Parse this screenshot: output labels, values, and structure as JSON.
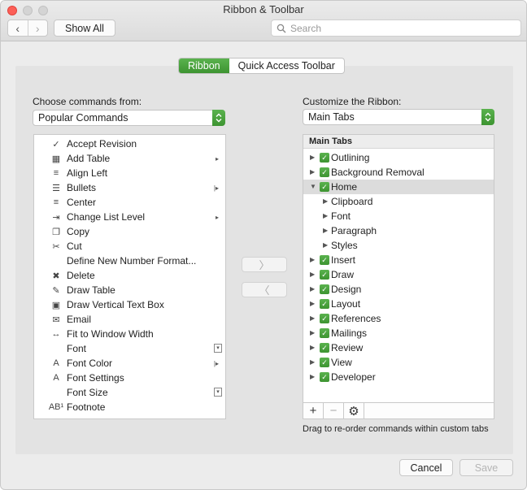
{
  "window": {
    "title": "Ribbon & Toolbar"
  },
  "toolbar": {
    "back_glyph": "‹",
    "forward_glyph": "›",
    "show_all": "Show All",
    "search_placeholder": "Search"
  },
  "tabs": [
    {
      "label": "Ribbon",
      "selected": true
    },
    {
      "label": "Quick Access Toolbar",
      "selected": false
    }
  ],
  "left": {
    "label": "Choose commands from:",
    "dropdown_value": "Popular Commands",
    "commands": [
      {
        "label": "Accept Revision",
        "icon": "accept-revision-icon",
        "glyph": "✓",
        "submenu": ""
      },
      {
        "label": "Add Table",
        "icon": "table-icon",
        "glyph": "▦",
        "submenu": "▸"
      },
      {
        "label": "Align Left",
        "icon": "align-left-icon",
        "glyph": "≡",
        "submenu": ""
      },
      {
        "label": "Bullets",
        "icon": "bullets-icon",
        "glyph": "☰",
        "submenu": "|▸"
      },
      {
        "label": "Center",
        "icon": "align-center-icon",
        "glyph": "≡",
        "submenu": ""
      },
      {
        "label": "Change List Level",
        "icon": "list-level-icon",
        "glyph": "⇥",
        "submenu": "▸"
      },
      {
        "label": "Copy",
        "icon": "copy-icon",
        "glyph": "❐",
        "submenu": ""
      },
      {
        "label": "Cut",
        "icon": "scissors-icon",
        "glyph": "✂",
        "submenu": ""
      },
      {
        "label": "Define New Number Format...",
        "icon": "",
        "glyph": "",
        "submenu": ""
      },
      {
        "label": "Delete",
        "icon": "delete-icon",
        "glyph": "✖",
        "submenu": ""
      },
      {
        "label": "Draw Table",
        "icon": "draw-table-icon",
        "glyph": "✎",
        "submenu": ""
      },
      {
        "label": "Draw Vertical Text Box",
        "icon": "text-box-icon",
        "glyph": "▣",
        "submenu": ""
      },
      {
        "label": "Email",
        "icon": "email-icon",
        "glyph": "✉",
        "submenu": ""
      },
      {
        "label": "Fit to Window Width",
        "icon": "fit-width-icon",
        "glyph": "↔",
        "submenu": ""
      },
      {
        "label": "Font",
        "icon": "",
        "glyph": "",
        "submenu": "box"
      },
      {
        "label": "Font Color",
        "icon": "font-color-icon",
        "glyph": "A",
        "submenu": "|▸"
      },
      {
        "label": "Font Settings",
        "icon": "font-settings-icon",
        "glyph": "A",
        "submenu": ""
      },
      {
        "label": "Font Size",
        "icon": "",
        "glyph": "",
        "submenu": "box"
      },
      {
        "label": "Footnote",
        "icon": "footnote-icon",
        "glyph": "AB¹",
        "submenu": ""
      }
    ]
  },
  "right": {
    "label": "Customize the Ribbon:",
    "dropdown_value": "Main Tabs",
    "tree_header": "Main Tabs",
    "tree": [
      {
        "label": "Outlining",
        "level": 0,
        "checked": true,
        "expanded": false
      },
      {
        "label": "Background Removal",
        "level": 0,
        "checked": true,
        "expanded": false
      },
      {
        "label": "Home",
        "level": 0,
        "checked": true,
        "expanded": true,
        "selected": true
      },
      {
        "label": "Clipboard",
        "level": 1,
        "checked": false,
        "expanded": false
      },
      {
        "label": "Font",
        "level": 1,
        "checked": false,
        "expanded": false
      },
      {
        "label": "Paragraph",
        "level": 1,
        "checked": false,
        "expanded": false
      },
      {
        "label": "Styles",
        "level": 1,
        "checked": false,
        "expanded": false
      },
      {
        "label": "Insert",
        "level": 0,
        "checked": true,
        "expanded": false
      },
      {
        "label": "Draw",
        "level": 0,
        "checked": true,
        "expanded": false
      },
      {
        "label": "Design",
        "level": 0,
        "checked": true,
        "expanded": false
      },
      {
        "label": "Layout",
        "level": 0,
        "checked": true,
        "expanded": false
      },
      {
        "label": "References",
        "level": 0,
        "checked": true,
        "expanded": false
      },
      {
        "label": "Mailings",
        "level": 0,
        "checked": true,
        "expanded": false
      },
      {
        "label": "Review",
        "level": 0,
        "checked": true,
        "expanded": false
      },
      {
        "label": "View",
        "level": 0,
        "checked": true,
        "expanded": false
      },
      {
        "label": "Developer",
        "level": 0,
        "checked": true,
        "expanded": false
      }
    ],
    "hint": "Drag to re-order commands within custom tabs"
  },
  "move": {
    "add_glyph": "〉",
    "remove_glyph": "〈"
  },
  "tree_toolbar": {
    "add": "+",
    "remove": "−",
    "settings": "⚙"
  },
  "footer": {
    "cancel": "Cancel",
    "save": "Save"
  },
  "colors": {
    "accent": "#45a03a"
  }
}
